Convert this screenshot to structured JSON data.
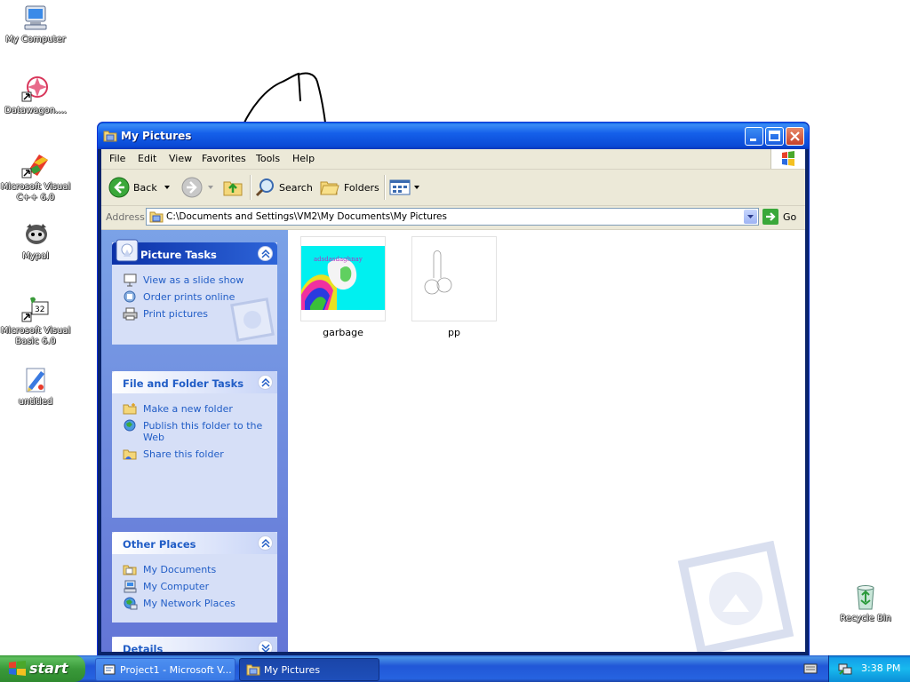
{
  "desktop": {
    "icons": [
      {
        "label": "My Computer",
        "icon": "my-computer-icon"
      },
      {
        "label": "Datawagon....",
        "icon": "datawagon-shortcut-icon"
      },
      {
        "label": "Microsoft Visual C++ 6.0",
        "icon": "visual-cpp-shortcut-icon"
      },
      {
        "label": "Mypal",
        "icon": "mypal-shortcut-icon"
      },
      {
        "label": "Microsoft Visual Basic 6.0",
        "icon": "visual-basic-shortcut-icon"
      },
      {
        "label": "untitled",
        "icon": "paint-image-icon"
      },
      {
        "label": "Recycle Bin",
        "icon": "recycle-bin-icon"
      }
    ]
  },
  "window": {
    "title": "My Pictures",
    "menu": [
      "File",
      "Edit",
      "View",
      "Favorites",
      "Tools",
      "Help"
    ],
    "toolbar": {
      "back": "Back",
      "search": "Search",
      "folders": "Folders"
    },
    "address": {
      "label": "Address",
      "value": "C:\\Documents and Settings\\VM2\\My Documents\\My Pictures",
      "go": "Go"
    }
  },
  "taskpane": {
    "picture_tasks": {
      "title": "Picture Tasks",
      "items": [
        "View as a slide show",
        "Order prints online",
        "Print pictures"
      ]
    },
    "file_folder_tasks": {
      "title": "File and Folder Tasks",
      "items": [
        "Make a new folder",
        "Publish this folder to the Web",
        "Share this folder"
      ]
    },
    "other_places": {
      "title": "Other Places",
      "items": [
        "My Documents",
        "My Computer",
        "My Network Places"
      ]
    },
    "details": {
      "title": "Details"
    }
  },
  "files": [
    {
      "name": "garbage",
      "thumb_text": "adsdasdaghnay"
    },
    {
      "name": "pp"
    }
  ],
  "taskbar": {
    "start": "start",
    "tasks": [
      "Project1 - Microsoft V...",
      "My Pictures"
    ],
    "clock": "3:38 PM"
  },
  "colors": {
    "link": "#215dc6",
    "taskpane_bg": "#7ba2e7",
    "titlebar": "#0a4ad6",
    "taskbar": "#2157d7",
    "start_green": "#3a9a3a"
  }
}
